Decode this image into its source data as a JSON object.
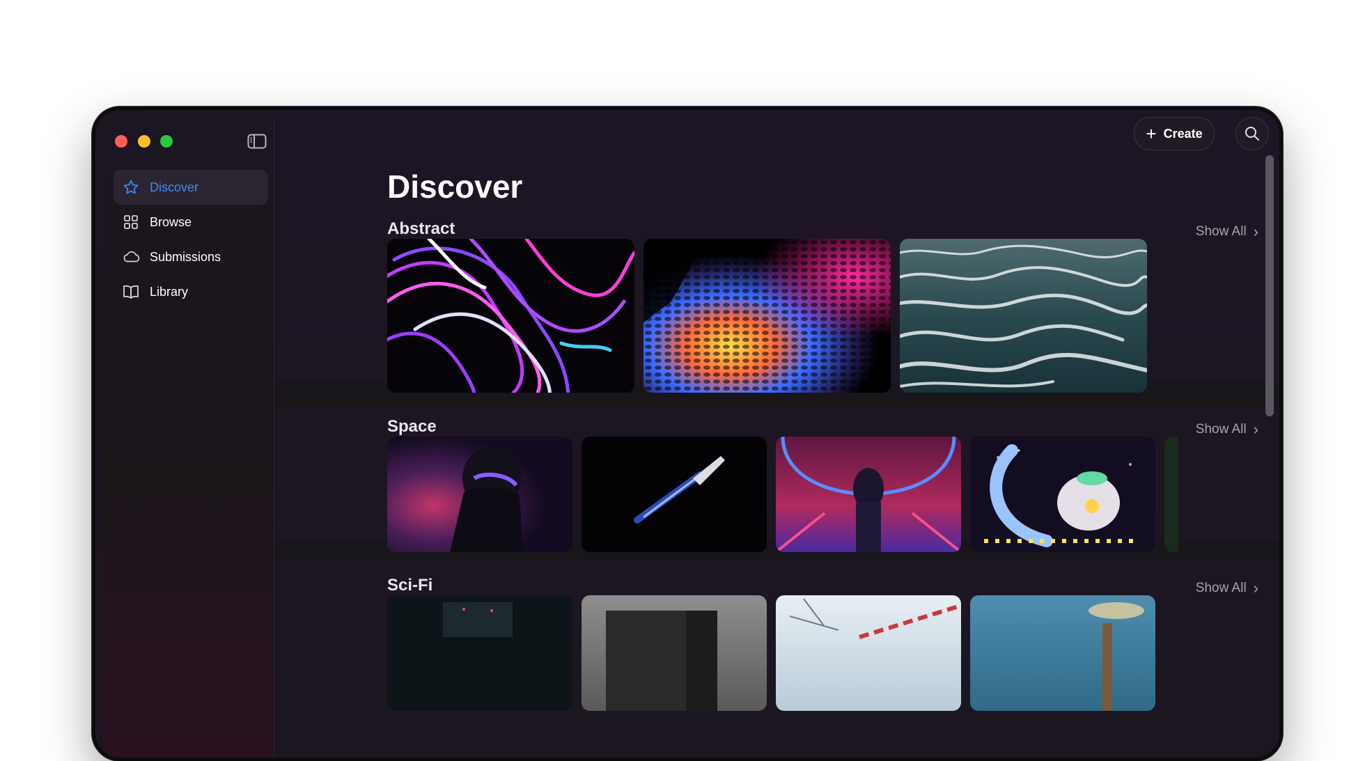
{
  "window": {
    "traffic_lights": [
      "close",
      "minimize",
      "zoom"
    ],
    "colors": {
      "close": "#ff5f57",
      "minimize": "#febc2e",
      "zoom": "#28c840"
    }
  },
  "sidebar": {
    "items": [
      {
        "label": "Discover",
        "icon": "star-icon",
        "active": true
      },
      {
        "label": "Browse",
        "icon": "grid-icon",
        "active": false
      },
      {
        "label": "Submissions",
        "icon": "cloud-icon",
        "active": false
      },
      {
        "label": "Library",
        "icon": "book-icon",
        "active": false
      }
    ],
    "accent": "#3d8bf5"
  },
  "toolbar": {
    "create_label": "Create",
    "search_icon": "search-icon"
  },
  "main": {
    "title": "Discover",
    "sections": [
      {
        "title": "Abstract",
        "show_all": "Show All"
      },
      {
        "title": "Space",
        "show_all": "Show All"
      },
      {
        "title": "Sci-Fi",
        "show_all": "Show All"
      }
    ]
  }
}
